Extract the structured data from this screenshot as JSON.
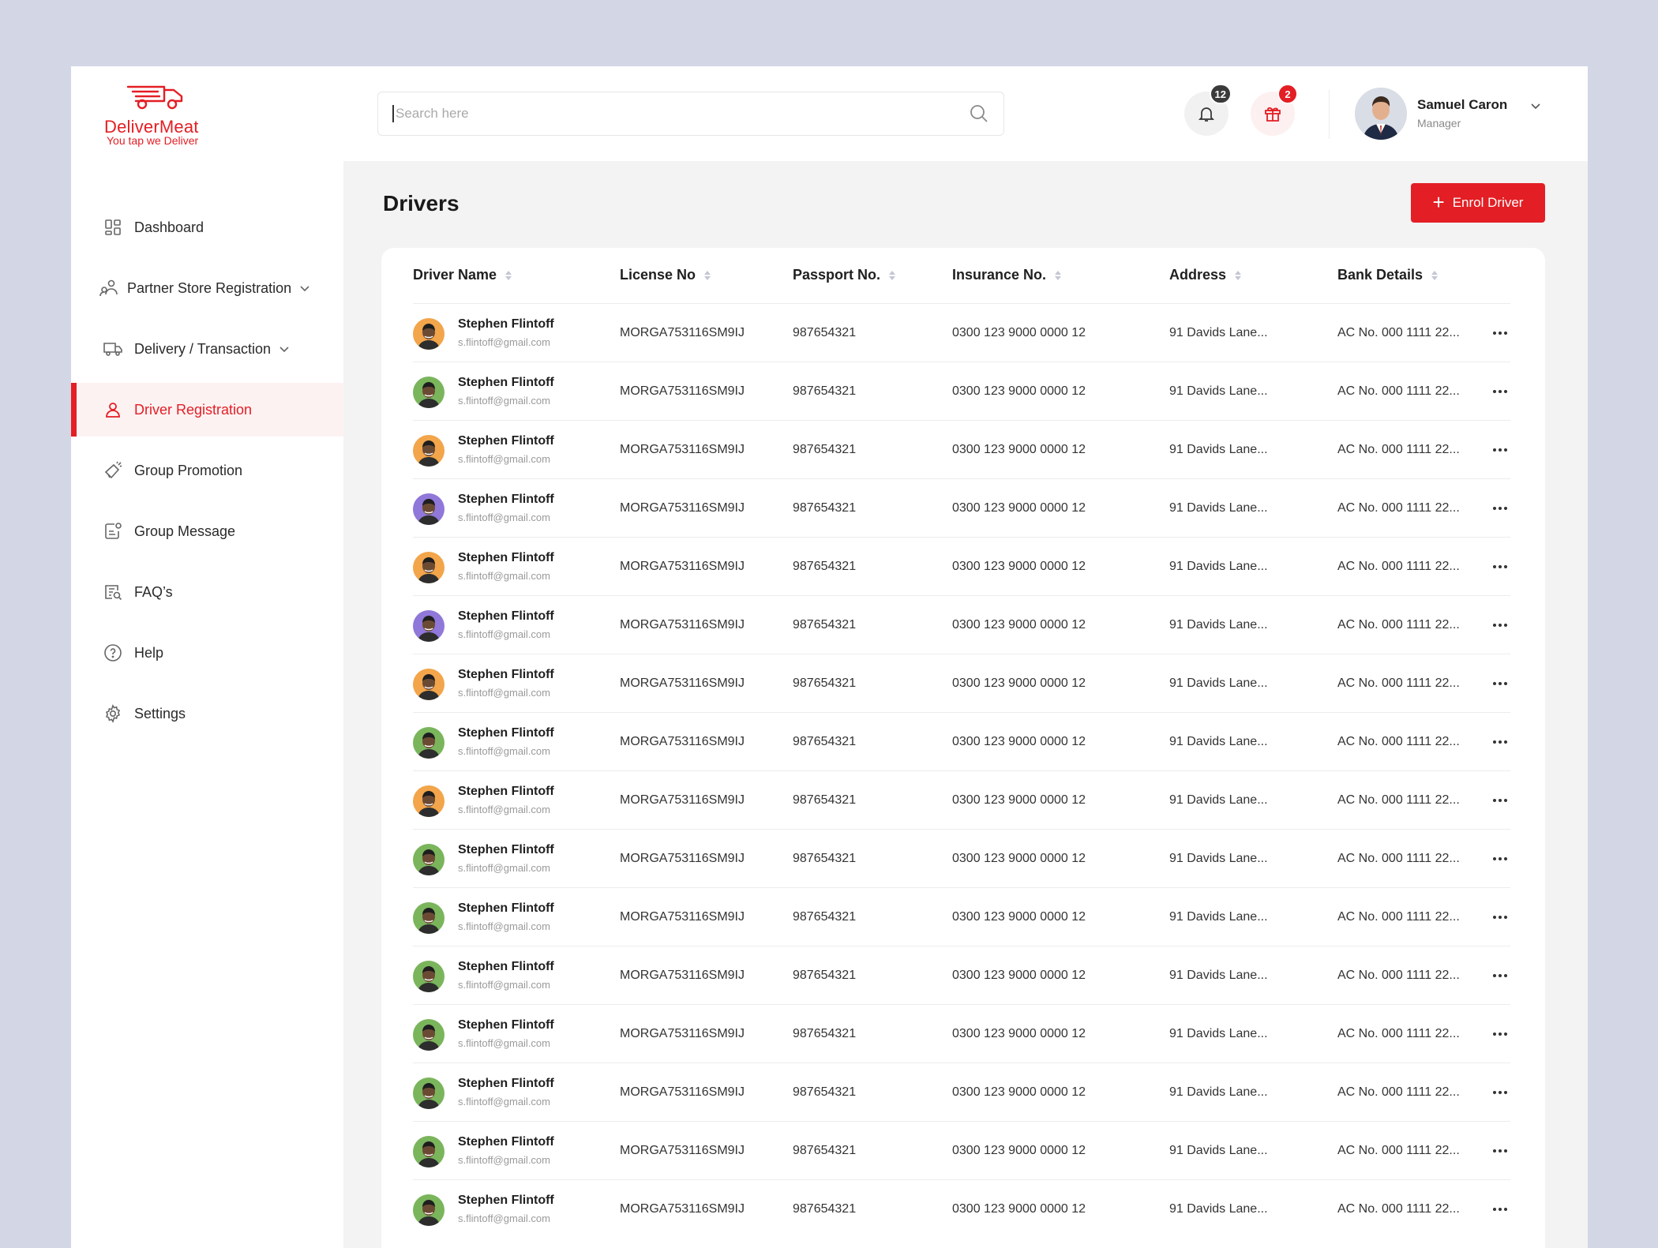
{
  "brand": {
    "name": "DeliverMeat",
    "tagline": "You tap we Deliver",
    "accent": "#e31e24"
  },
  "sidebar": {
    "items": [
      {
        "label": "Dashboard",
        "icon": "dashboard-icon",
        "active": false,
        "has_chevron": false
      },
      {
        "label": "Partner Store Registration",
        "icon": "partner-store-icon",
        "active": false,
        "has_chevron": true
      },
      {
        "label": "Delivery / Transaction",
        "icon": "truck-icon",
        "active": false,
        "has_chevron": true
      },
      {
        "label": "Driver Registration",
        "icon": "user-icon",
        "active": true,
        "has_chevron": false
      },
      {
        "label": "Group Promotion",
        "icon": "megaphone-icon",
        "active": false,
        "has_chevron": false
      },
      {
        "label": "Group Message",
        "icon": "message-icon",
        "active": false,
        "has_chevron": false
      },
      {
        "label": "FAQ’s",
        "icon": "faq-icon",
        "active": false,
        "has_chevron": false
      },
      {
        "label": "Help",
        "icon": "help-icon",
        "active": false,
        "has_chevron": false
      },
      {
        "label": "Settings",
        "icon": "gear-icon",
        "active": false,
        "has_chevron": false
      }
    ]
  },
  "header": {
    "search": {
      "placeholder": "Search here",
      "value": ""
    },
    "notifications": {
      "icon": "bell-icon",
      "count": "12"
    },
    "gifts": {
      "icon": "gift-icon",
      "count": "2"
    },
    "user": {
      "name": "Samuel Caron",
      "role": "Manager"
    }
  },
  "main": {
    "title": "Drivers",
    "enrol_label": "Enrol Driver",
    "columns": [
      "Driver Name",
      "License No",
      "Passport No.",
      "Insurance No.",
      "Address",
      "Bank Details"
    ],
    "rows": [
      {
        "name": "Stephen Flintoff",
        "email": "s.flintoff@gmail.com",
        "license": "MORGA753116SM9IJ",
        "passport": "987654321",
        "insurance": "0300 123 9000 0000 12",
        "address": "91 Davids Lane...",
        "bank": "AC No. 000 1111 22...",
        "avatar_color": "#f2a54a"
      },
      {
        "name": "Stephen Flintoff",
        "email": "s.flintoff@gmail.com",
        "license": "MORGA753116SM9IJ",
        "passport": "987654321",
        "insurance": "0300 123 9000 0000 12",
        "address": "91 Davids Lane...",
        "bank": "AC No. 000 1111 22...",
        "avatar_color": "#7ab55c"
      },
      {
        "name": "Stephen Flintoff",
        "email": "s.flintoff@gmail.com",
        "license": "MORGA753116SM9IJ",
        "passport": "987654321",
        "insurance": "0300 123 9000 0000 12",
        "address": "91 Davids Lane...",
        "bank": "AC No. 000 1111 22...",
        "avatar_color": "#f2a54a"
      },
      {
        "name": "Stephen Flintoff",
        "email": "s.flintoff@gmail.com",
        "license": "MORGA753116SM9IJ",
        "passport": "987654321",
        "insurance": "0300 123 9000 0000 12",
        "address": "91 Davids Lane...",
        "bank": "AC No. 000 1111 22...",
        "avatar_color": "#8f78d9"
      },
      {
        "name": "Stephen Flintoff",
        "email": "s.flintoff@gmail.com",
        "license": "MORGA753116SM9IJ",
        "passport": "987654321",
        "insurance": "0300 123 9000 0000 12",
        "address": "91 Davids Lane...",
        "bank": "AC No. 000 1111 22...",
        "avatar_color": "#f2a54a"
      },
      {
        "name": "Stephen Flintoff",
        "email": "s.flintoff@gmail.com",
        "license": "MORGA753116SM9IJ",
        "passport": "987654321",
        "insurance": "0300 123 9000 0000 12",
        "address": "91 Davids Lane...",
        "bank": "AC No. 000 1111 22...",
        "avatar_color": "#8f78d9"
      },
      {
        "name": "Stephen Flintoff",
        "email": "s.flintoff@gmail.com",
        "license": "MORGA753116SM9IJ",
        "passport": "987654321",
        "insurance": "0300 123 9000 0000 12",
        "address": "91 Davids Lane...",
        "bank": "AC No. 000 1111 22...",
        "avatar_color": "#f2a54a"
      },
      {
        "name": "Stephen Flintoff",
        "email": "s.flintoff@gmail.com",
        "license": "MORGA753116SM9IJ",
        "passport": "987654321",
        "insurance": "0300 123 9000 0000 12",
        "address": "91 Davids Lane...",
        "bank": "AC No. 000 1111 22...",
        "avatar_color": "#7ab55c"
      },
      {
        "name": "Stephen Flintoff",
        "email": "s.flintoff@gmail.com",
        "license": "MORGA753116SM9IJ",
        "passport": "987654321",
        "insurance": "0300 123 9000 0000 12",
        "address": "91 Davids Lane...",
        "bank": "AC No. 000 1111 22...",
        "avatar_color": "#f2a54a"
      },
      {
        "name": "Stephen Flintoff",
        "email": "s.flintoff@gmail.com",
        "license": "MORGA753116SM9IJ",
        "passport": "987654321",
        "insurance": "0300 123 9000 0000 12",
        "address": "91 Davids Lane...",
        "bank": "AC No. 000 1111 22...",
        "avatar_color": "#7ab55c"
      },
      {
        "name": "Stephen Flintoff",
        "email": "s.flintoff@gmail.com",
        "license": "MORGA753116SM9IJ",
        "passport": "987654321",
        "insurance": "0300 123 9000 0000 12",
        "address": "91 Davids Lane...",
        "bank": "AC No. 000 1111 22...",
        "avatar_color": "#7ab55c"
      },
      {
        "name": "Stephen Flintoff",
        "email": "s.flintoff@gmail.com",
        "license": "MORGA753116SM9IJ",
        "passport": "987654321",
        "insurance": "0300 123 9000 0000 12",
        "address": "91 Davids Lane...",
        "bank": "AC No. 000 1111 22...",
        "avatar_color": "#7ab55c"
      },
      {
        "name": "Stephen Flintoff",
        "email": "s.flintoff@gmail.com",
        "license": "MORGA753116SM9IJ",
        "passport": "987654321",
        "insurance": "0300 123 9000 0000 12",
        "address": "91 Davids Lane...",
        "bank": "AC No. 000 1111 22...",
        "avatar_color": "#7ab55c"
      },
      {
        "name": "Stephen Flintoff",
        "email": "s.flintoff@gmail.com",
        "license": "MORGA753116SM9IJ",
        "passport": "987654321",
        "insurance": "0300 123 9000 0000 12",
        "address": "91 Davids Lane...",
        "bank": "AC No. 000 1111 22...",
        "avatar_color": "#7ab55c"
      },
      {
        "name": "Stephen Flintoff",
        "email": "s.flintoff@gmail.com",
        "license": "MORGA753116SM9IJ",
        "passport": "987654321",
        "insurance": "0300 123 9000 0000 12",
        "address": "91 Davids Lane...",
        "bank": "AC No. 000 1111 22...",
        "avatar_color": "#7ab55c"
      },
      {
        "name": "Stephen Flintoff",
        "email": "s.flintoff@gmail.com",
        "license": "MORGA753116SM9IJ",
        "passport": "987654321",
        "insurance": "0300 123 9000 0000 12",
        "address": "91 Davids Lane...",
        "bank": "AC No. 000 1111 22...",
        "avatar_color": "#7ab55c"
      }
    ]
  }
}
